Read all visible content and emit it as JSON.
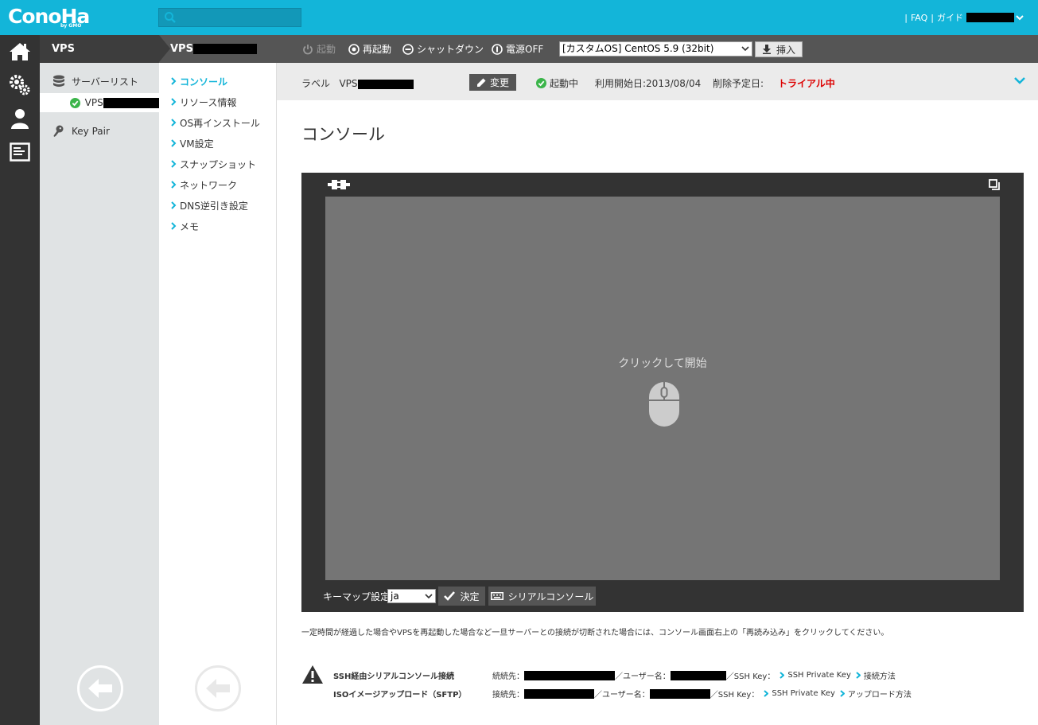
{
  "header": {
    "logo": "ConoHa",
    "logo_sub": "by GMO",
    "search_placeholder": "",
    "faq": "FAQ",
    "guide": "ガイド"
  },
  "col1": {
    "title": "VPS",
    "items": [
      {
        "label": "サーバーリスト"
      },
      {
        "label": "VPS"
      },
      {
        "label": "Key Pair"
      }
    ]
  },
  "col2": {
    "title": "VPS",
    "nav": [
      {
        "label": "コンソール"
      },
      {
        "label": "リソース情報"
      },
      {
        "label": "OS再インストール"
      },
      {
        "label": "VM設定"
      },
      {
        "label": "スナップショット"
      },
      {
        "label": "ネットワーク"
      },
      {
        "label": "DNS逆引き設定"
      },
      {
        "label": "メモ"
      }
    ]
  },
  "toolbar": {
    "start": "起動",
    "restart": "再起動",
    "shutdown": "シャットダウン",
    "power_off": "電源OFF",
    "os_selected": "[カスタムOS] CentOS 5.9 (32bit)",
    "insert": "挿入"
  },
  "labelbar": {
    "label_prefix": "ラベル",
    "label_value": "VPS",
    "edit": "変更",
    "status": "起動中",
    "start_date": "利用開始日:2013/08/04",
    "delete_label": "削除予定日:",
    "trial": "トライアル中"
  },
  "page": {
    "title": "コンソール"
  },
  "console": {
    "click_to_start": "クリックして開始",
    "keymap_label": "キーマップ設定",
    "keymap_value": "ja",
    "decide": "決定",
    "serial_console": "シリアルコンソール"
  },
  "note": "一定時間が経過した場合やVPSを再起動した場合など一旦サーバーとの接続が切断された場合には、コンソール画面右上の「再読み込み」をクリックしてください。",
  "ssh": {
    "row1_title": "SSH経由シリアルコンソール接続",
    "row1_dest": "続続先：",
    "row1_user": "／ユーザー名：",
    "row1_key": "／SSH Key：",
    "row1_key_link": "SSH Private Key",
    "row1_method": "接続方法",
    "row2_title": "ISOイメージアップロード（SFTP）",
    "row2_dest": "接続先：",
    "row2_user": "／ユーザー名：",
    "row2_key": "／SSH Key：",
    "row2_key_link": "SSH Private Key",
    "row2_method": "アップロード方法"
  },
  "colors": {
    "brand": "#13b5d9",
    "trial": "#dd0000",
    "ok": "#3bb54a"
  }
}
